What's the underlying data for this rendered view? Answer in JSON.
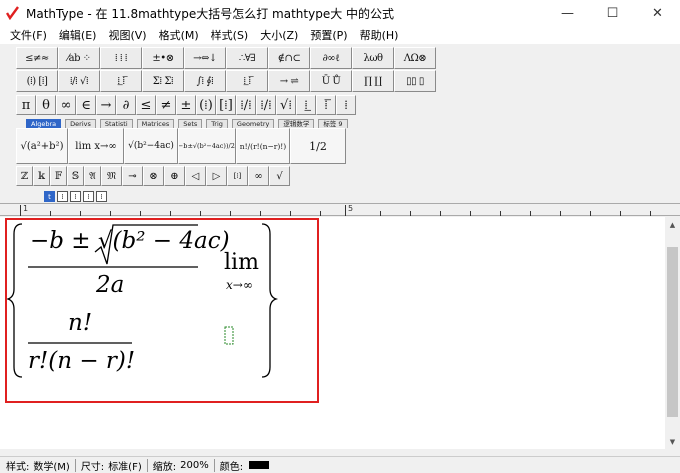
{
  "window": {
    "title": "MathType - 在 11.8mathtype大括号怎么打 mathtype大 中的公式",
    "controls": {
      "minimize": "—",
      "maximize": "☐",
      "close": "✕"
    }
  },
  "menu": [
    {
      "label": "文件(F)"
    },
    {
      "label": "编辑(E)"
    },
    {
      "label": "视图(V)"
    },
    {
      "label": "格式(M)"
    },
    {
      "label": "样式(S)"
    },
    {
      "label": "大小(Z)"
    },
    {
      "label": "预置(P)"
    },
    {
      "label": "帮助(H)"
    }
  ],
  "toolbar": {
    "row1": [
      "≤≠≈",
      "⁄ab ⁘",
      "⁞ ⁞ ⁞",
      "±•⊗",
      "→⇔↓",
      "∴∀∃",
      "∉∩⊂",
      "∂∞ℓ",
      "λωθ",
      "ΛΩ⊗"
    ],
    "row2": [
      "(⁞) [⁞]",
      "⁞/⁞ √⁞",
      "⁞̲ ⁞̅",
      "Σ⁞ Σ⁞",
      "∫⁞ ∮⁞",
      "⁞̲ ⁞̅",
      "→ ⇌",
      "Ū Ů",
      "∏ ∐",
      "▯▯ ▯"
    ],
    "row3": [
      "π",
      "θ",
      "∞",
      "∈",
      "→",
      "∂",
      "≤",
      "≠",
      "±",
      "(⁞)",
      "[⁞]",
      "⁞/⁞",
      "⁞/⁞",
      "√⁞",
      "⁞̲",
      "⁞̅",
      "⁞"
    ],
    "tabs": [
      {
        "label": "Algebra",
        "active": true
      },
      {
        "label": "Derivs"
      },
      {
        "label": "Statisti"
      },
      {
        "label": "Matrices"
      },
      {
        "label": "Sets"
      },
      {
        "label": "Trig"
      },
      {
        "label": "Geometry"
      },
      {
        "label": "逻辑数学"
      },
      {
        "label": "标签 9"
      }
    ],
    "templates": [
      {
        "label": "√(a²+b²)"
      },
      {
        "label": "lim x→∞"
      },
      {
        "label": "√(b²−4ac)"
      },
      {
        "label": "(−b±√(b²−4ac))/2a"
      },
      {
        "label": "n!/(r!(n−r)!)"
      },
      {
        "label": "1/2"
      }
    ],
    "row4": [
      "ℤ",
      "𝕜",
      "𝔽",
      "𝕊",
      "𝔄",
      "𝔐",
      "⊸",
      "⊗",
      "⊕",
      "◁",
      "▷",
      "[⁞]",
      "∞",
      "√"
    ]
  },
  "style_strip": [
    "t",
    "⁞",
    "⁞",
    "⁞",
    "⁞"
  ],
  "ruler": {
    "labels": [
      "1",
      "5"
    ]
  },
  "equation": {
    "top_num": "−b ± √(b² − 4ac)",
    "top_den": "2a",
    "lim": "lim",
    "lim_sub": "x→∞",
    "bot_num": "n!",
    "bot_den": "r!(n − r)!"
  },
  "status": {
    "style_label": "样式:",
    "style_value": "数学(M)",
    "size_label": "尺寸:",
    "size_value": "标准(F)",
    "zoom_label": "缩放:",
    "zoom_value": "200%",
    "color_label": "颜色:",
    "color_value": "#000000"
  }
}
